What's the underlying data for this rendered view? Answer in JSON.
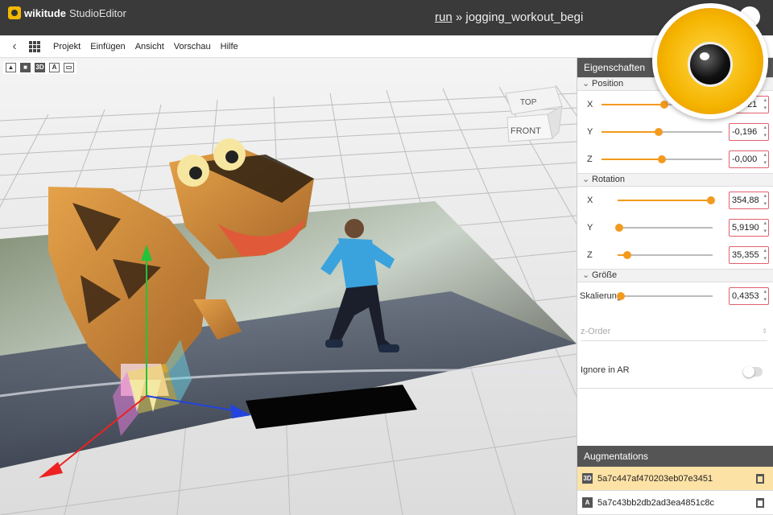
{
  "app": {
    "logo_bold": "wikitude",
    "logo_rest": "StudioEditor",
    "crumb_link": "run",
    "crumb_sep": " » ",
    "crumb_name": "jogging_workout_begi"
  },
  "menu": {
    "items": [
      "Projekt",
      "Einfügen",
      "Ansicht",
      "Vorschau",
      "Hilfe"
    ]
  },
  "tools": [
    "image",
    "video",
    "3D",
    "A",
    "widget"
  ],
  "viewcube": {
    "top": "TOP",
    "front": "FRONT"
  },
  "panel": {
    "title": "Eigenschaften",
    "position": {
      "label": "Position",
      "rows": [
        {
          "axis": "X",
          "value": "-0,021",
          "level": 0.52
        },
        {
          "axis": "Y",
          "value": "-0,196",
          "level": 0.47
        },
        {
          "axis": "Z",
          "value": "-0,000",
          "level": 0.5
        }
      ]
    },
    "rotation": {
      "label": "Rotation",
      "rows": [
        {
          "axis": "X",
          "value": "354,88",
          "level": 0.98
        },
        {
          "axis": "Y",
          "value": "5,9190",
          "level": 0.02
        },
        {
          "axis": "Z",
          "value": "35,355",
          "level": 0.1
        }
      ]
    },
    "size": {
      "label": "Größe",
      "row": {
        "axis": "Skalierung",
        "value": "0,4353",
        "level": 0.0
      }
    },
    "zorder_placeholder": "z-Order",
    "ignore_label": "Ignore in AR",
    "ignore_on": false
  },
  "augmentations": {
    "title": "Augmentations",
    "items": [
      {
        "badge": "3D",
        "name": "5a7c447af470203eb07e3451",
        "selected": true
      },
      {
        "badge": "A",
        "name": "5a7c43bb2db2ad3ea4851c8c",
        "selected": false
      }
    ]
  },
  "colors": {
    "accent": "#f39a1e",
    "header": "#3a3a3a",
    "selected_row": "#fde2a6"
  }
}
